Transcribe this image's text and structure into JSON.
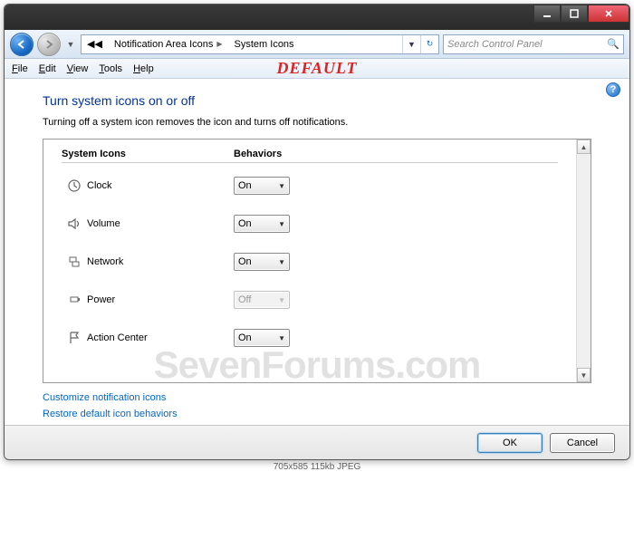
{
  "breadcrumb": {
    "seg1": "Notification Area Icons",
    "seg2": "System Icons"
  },
  "search": {
    "placeholder": "Search Control Panel"
  },
  "menu": {
    "file": "File",
    "edit": "Edit",
    "view": "View",
    "tools": "Tools",
    "help": "Help"
  },
  "overlay": "DEFAULT",
  "heading": "Turn system icons on or off",
  "subtext": "Turning off a system icon removes the icon and turns off notifications.",
  "columns": {
    "c1": "System Icons",
    "c2": "Behaviors"
  },
  "rows": [
    {
      "name": "Clock",
      "value": "On",
      "disabled": false,
      "icon": "clock-icon"
    },
    {
      "name": "Volume",
      "value": "On",
      "disabled": false,
      "icon": "volume-icon"
    },
    {
      "name": "Network",
      "value": "On",
      "disabled": false,
      "icon": "network-icon"
    },
    {
      "name": "Power",
      "value": "Off",
      "disabled": true,
      "icon": "power-icon"
    },
    {
      "name": "Action Center",
      "value": "On",
      "disabled": false,
      "icon": "flag-icon"
    }
  ],
  "links": {
    "customize": "Customize notification icons",
    "restore": "Restore default icon behaviors"
  },
  "buttons": {
    "ok": "OK",
    "cancel": "Cancel"
  },
  "watermark": "SevenForums.com",
  "imgmeta": "705x585   115kb   JPEG"
}
